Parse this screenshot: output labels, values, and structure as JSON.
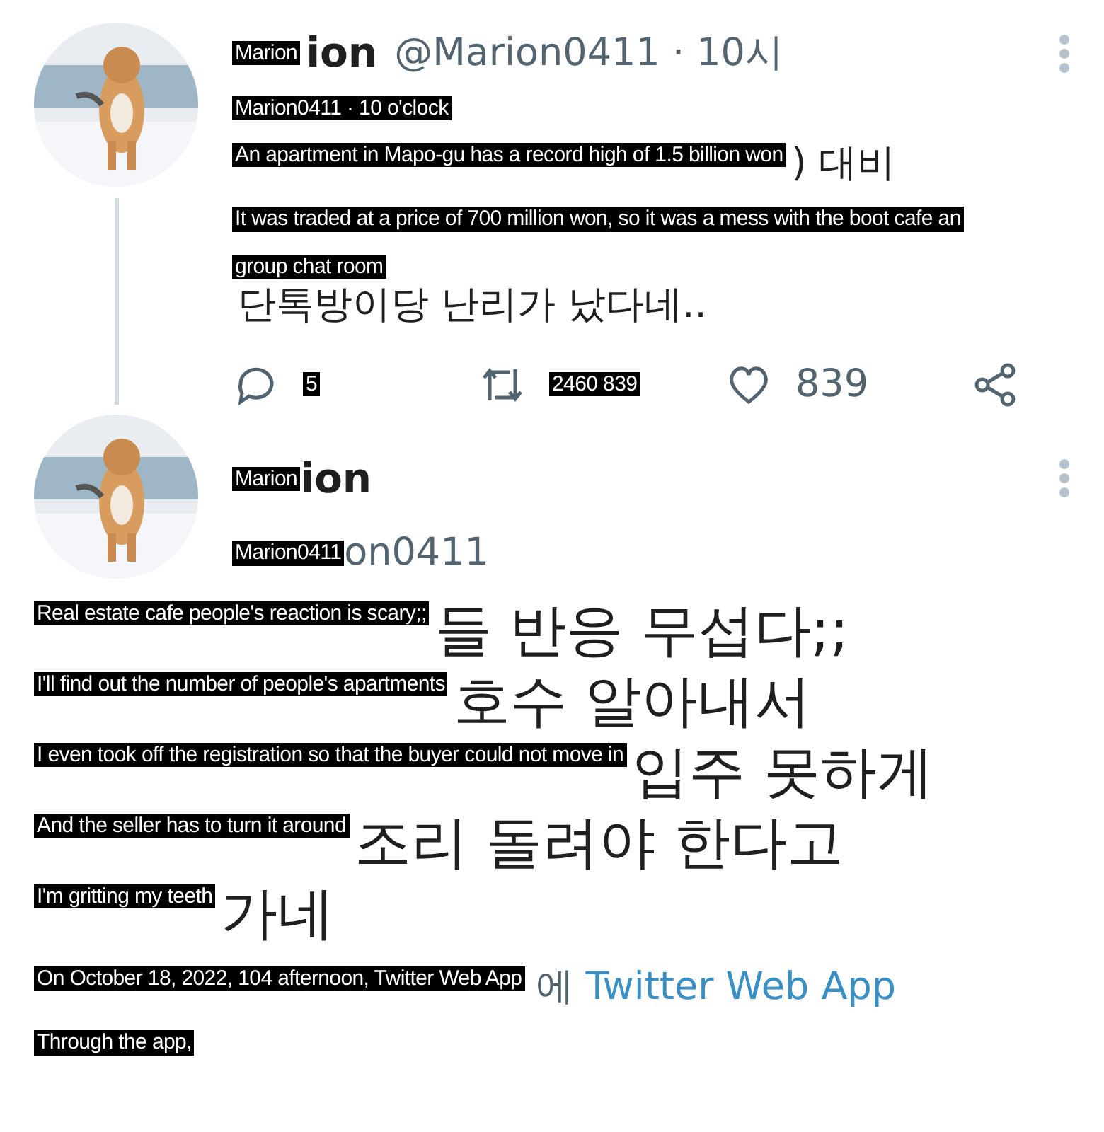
{
  "tweets": [
    {
      "avatar": {
        "kind": "picture"
      },
      "name_label": "Marion",
      "name_rest": "ion",
      "handle": "@Marion0411 · 10시",
      "lines": [
        {
          "label": "Marion0411 · 10 o'clock"
        },
        {
          "label": "An apartment in Mapo-gu has a record high of 1.5 billion won",
          "rest": ") 대비"
        },
        {
          "label": "It was traded at a price of 700 million won, so it was a mess with the boot cafe an"
        },
        {
          "label": "group chat room"
        },
        {
          "rest": "단톡방이당 난리가 났다네.."
        }
      ],
      "actions": [
        {
          "kind": "reply",
          "count": "5",
          "boxed": true
        },
        {
          "kind": "retweet",
          "count": "2460 839",
          "boxed": true
        },
        {
          "kind": "like",
          "count": "839",
          "boxed": false
        },
        {
          "kind": "share"
        }
      ]
    },
    {
      "avatar": {
        "kind": "picture"
      },
      "name_label": "Marion",
      "name_rest": "ion",
      "handle_label": "Marion0411",
      "handle_rest": "on0411",
      "lines": [
        {
          "label": "Real estate cafe people's reaction is scary;;",
          "rest": "들 반응 무섭다;;"
        },
        {
          "label": "I'll find out the number of people's apartments",
          "rest": "호수 알아내서"
        },
        {
          "label": "I even took off the registration so that the buyer could not move in",
          "rest": "입주 못하게"
        },
        {
          "label": "And the seller has to turn it around",
          "rest": "조리 돌려야 한다고"
        },
        {
          "label": "I'm gritting my teeth",
          "rest": "가네"
        }
      ],
      "meta": {
        "label": "On October 18, 2022, 104 afternoon, Twitter Web App",
        "rest": "에",
        "link": "Twitter Web App"
      },
      "footer_label": "Through the app,"
    }
  ]
}
